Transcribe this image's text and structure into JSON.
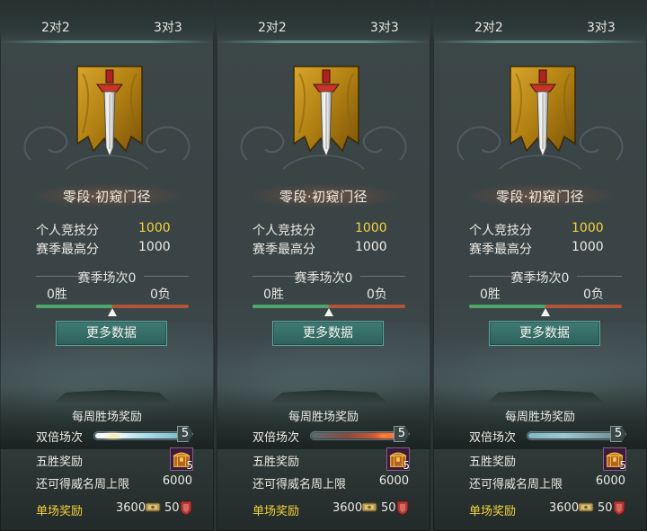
{
  "panels": [
    {
      "tabs": [
        "2对2",
        "3对3"
      ],
      "rank_title": "零段·初窥门径",
      "personal_score_label": "个人竞技分",
      "personal_score": "1000",
      "season_high_label": "赛季最高分",
      "season_high": "1000",
      "season_matches": "赛季场次0",
      "wins": "0胜",
      "losses": "0负",
      "win_ratio": 0.5,
      "more_data_button": "更多数据",
      "weekly_reward_title": "每周胜场奖励",
      "double_matches_label": "双倍场次",
      "double_matches_count": "5",
      "double_matches_state": "full",
      "five_wins_label": "五胜奖励",
      "five_wins_count": "5",
      "fame_cap_label": "还可得威名周上限",
      "fame_cap_value": "6000",
      "single_reward_label": "单场奖励",
      "single_reward_coins": "3600",
      "single_reward_honor": "50",
      "icons": [
        "sword-banner-emblem-icon",
        "coin-icon",
        "shield-icon",
        "treasure-chest-icon"
      ]
    },
    {
      "tabs": [
        "2对2",
        "3对3"
      ],
      "rank_title": "零段·初窥门径",
      "personal_score_label": "个人竞技分",
      "personal_score": "1000",
      "season_high_label": "赛季最高分",
      "season_high": "1000",
      "season_matches": "赛季场次0",
      "wins": "0胜",
      "losses": "0负",
      "win_ratio": 0.5,
      "more_data_button": "更多数据",
      "weekly_reward_title": "每周胜场奖励",
      "double_matches_label": "双倍场次",
      "double_matches_count": "5",
      "double_matches_state": "active",
      "five_wins_label": "五胜奖励",
      "five_wins_count": "5",
      "fame_cap_label": "还可得威名周上限",
      "fame_cap_value": "6000",
      "single_reward_label": "单场奖励",
      "single_reward_coins": "3600",
      "single_reward_honor": "50",
      "icons": [
        "sword-banner-emblem-icon",
        "coin-icon",
        "shield-icon",
        "treasure-chest-icon"
      ]
    },
    {
      "tabs": [
        "2对2",
        "3对3"
      ],
      "rank_title": "零段·初窥门径",
      "personal_score_label": "个人竞技分",
      "personal_score": "1000",
      "season_high_label": "赛季最高分",
      "season_high": "1000",
      "season_matches": "赛季场次0",
      "wins": "0胜",
      "losses": "0负",
      "win_ratio": 0.5,
      "more_data_button": "更多数据",
      "weekly_reward_title": "每周胜场奖励",
      "double_matches_label": "双倍场次",
      "double_matches_count": "5",
      "double_matches_state": "empty",
      "five_wins_label": "五胜奖励",
      "five_wins_count": "5",
      "fame_cap_label": "还可得威名周上限",
      "fame_cap_value": "6000",
      "single_reward_label": "单场奖励",
      "single_reward_coins": "3600",
      "single_reward_honor": "50",
      "icons": [
        "sword-banner-emblem-icon",
        "coin-icon",
        "shield-icon",
        "treasure-chest-icon"
      ]
    }
  ],
  "colors": {
    "gold_text": "#f3d33a",
    "win_green": "#4fa66c",
    "loss_red": "#b0543a",
    "button_teal": "#3f7b74",
    "banner_gold": "#b8860b"
  }
}
